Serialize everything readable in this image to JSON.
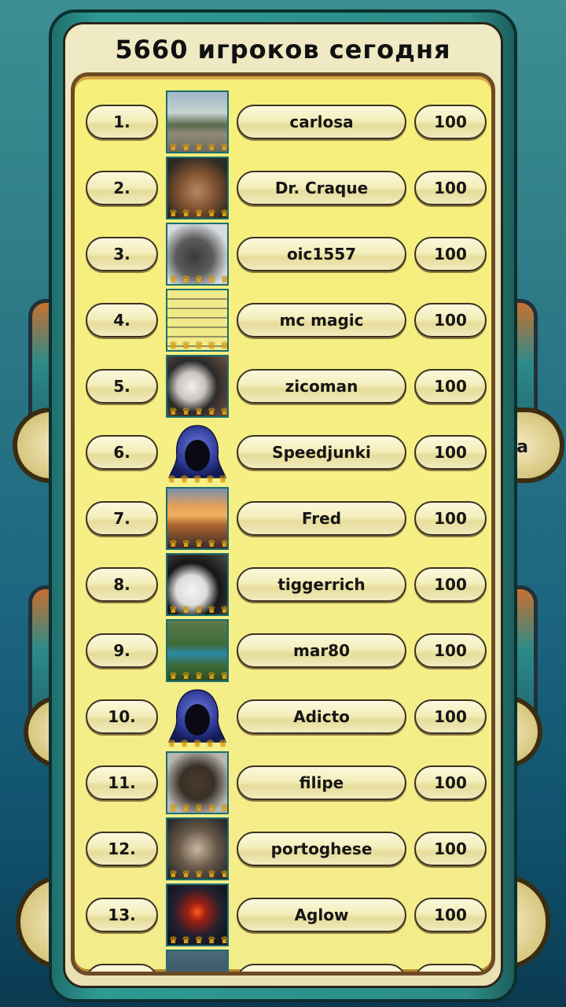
{
  "header": {
    "title": "5660 игроков сегодня"
  },
  "background": {
    "partial_label": "a"
  },
  "crown_glyph": "♛",
  "leaderboard": [
    {
      "rank": "1.",
      "name": "carlosa",
      "score": "100",
      "avatar": "photo-street"
    },
    {
      "rank": "2.",
      "name": "Dr. Craque",
      "score": "100",
      "avatar": "photo-laughing-man"
    },
    {
      "rank": "3.",
      "name": "oic1557",
      "score": "100",
      "avatar": "photo-blurry-face"
    },
    {
      "rank": "4.",
      "name": "mc magic",
      "score": "100",
      "avatar": "screenshot-leaderboard"
    },
    {
      "rank": "5.",
      "name": "zicoman",
      "score": "100",
      "avatar": "photo-dog"
    },
    {
      "rank": "6.",
      "name": "Speedjunki",
      "score": "100",
      "avatar": "default-hood"
    },
    {
      "rank": "7.",
      "name": "Fred",
      "score": "100",
      "avatar": "photo-sunset"
    },
    {
      "rank": "8.",
      "name": "tiggerrich",
      "score": "100",
      "avatar": "photo-cat"
    },
    {
      "rank": "9.",
      "name": "mar80",
      "score": "100",
      "avatar": "photo-person-garden"
    },
    {
      "rank": "10.",
      "name": "Adicto",
      "score": "100",
      "avatar": "default-hood"
    },
    {
      "rank": "11.",
      "name": "filipe",
      "score": "100",
      "avatar": "photo-person-dark"
    },
    {
      "rank": "12.",
      "name": "portoghese",
      "score": "100",
      "avatar": "photo-wolf"
    },
    {
      "rank": "13.",
      "name": "Aglow",
      "score": "100",
      "avatar": "photo-volcano"
    }
  ]
}
